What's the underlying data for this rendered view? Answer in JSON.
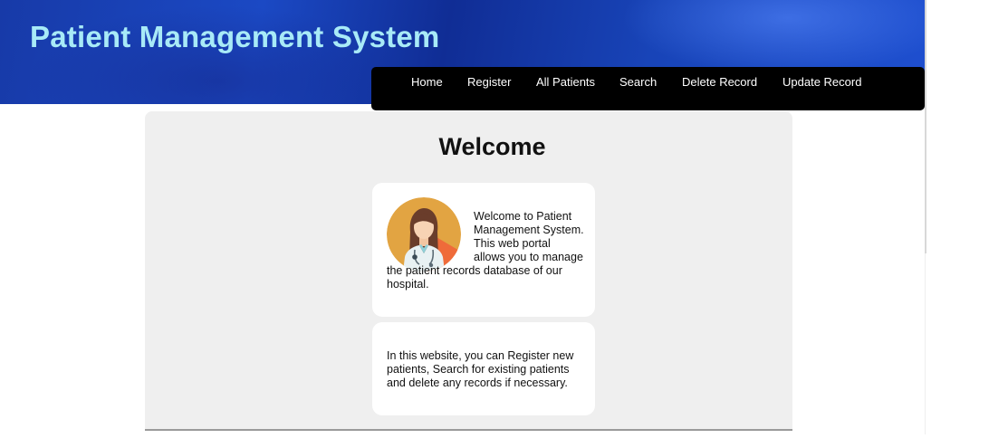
{
  "header": {
    "title": "Patient Management System"
  },
  "nav": {
    "items": [
      {
        "label": "Home"
      },
      {
        "label": "Register"
      },
      {
        "label": "All Patients"
      },
      {
        "label": "Search"
      },
      {
        "label": "Delete Record"
      },
      {
        "label": "Update Record"
      }
    ]
  },
  "main": {
    "heading": "Welcome",
    "card1": {
      "icon": "doctor-avatar-icon",
      "text": "Welcome to Patient Management System. This web portal allows you to manage the patient records database of our hospital."
    },
    "card2": {
      "text": "In this website, you can Register new patients, Search for existing patients and delete any records if necessary."
    }
  },
  "colors": {
    "header_bg": "#1b49c4",
    "title": "#a8eaf7",
    "nav_bg": "#000000",
    "panel_bg": "#efefef",
    "card_bg": "#ffffff"
  }
}
